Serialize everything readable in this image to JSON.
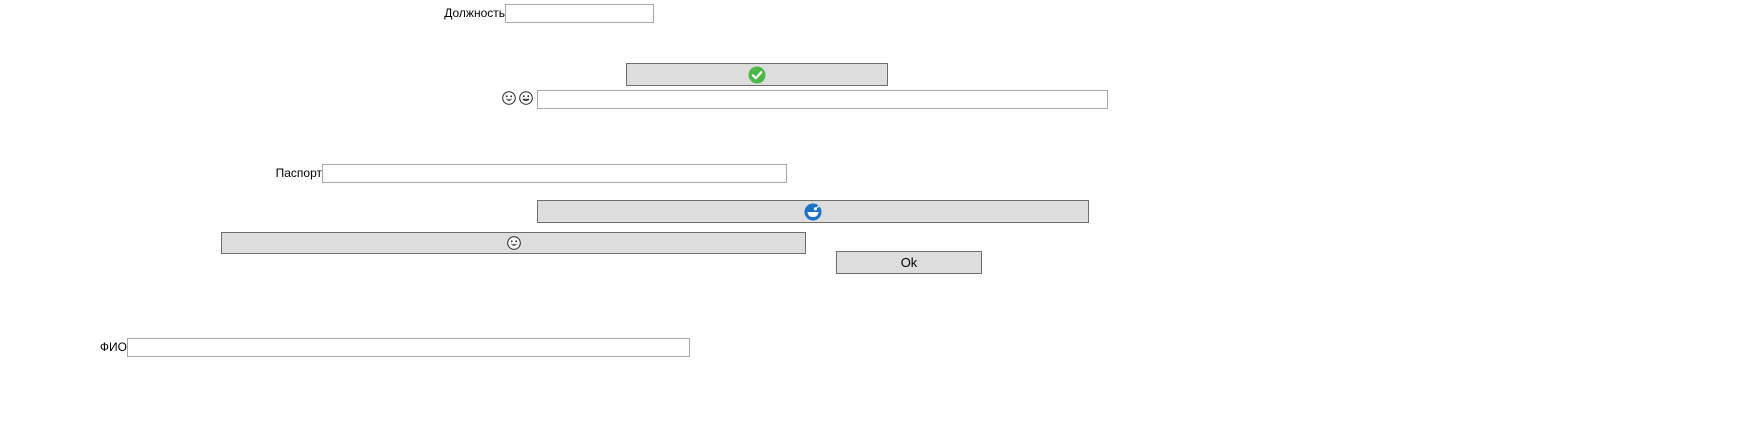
{
  "form": {
    "position_label": "Должность",
    "position_value": "",
    "passport_label": "Паспорт",
    "passport_value": "",
    "fullname_label": "ФИО",
    "fullname_value": "",
    "emoji_row_value": "",
    "ok_button_label": "Ok"
  },
  "icons": {
    "confirm_button_icon": "checkmark-circle-icon",
    "emoji_row_icons": [
      "grinning-face-icon",
      "smiling-face-icon"
    ],
    "blue_button_icon": "bowl-smile-icon",
    "emoji_button_icon": "grinning-face-icon"
  },
  "colors": {
    "button_bg": "#dddddd",
    "button_border": "#6e6e6e",
    "field_border": "#a8a8a8",
    "check_green": "#4cb84a",
    "blue_icon": "#1a73c8"
  }
}
